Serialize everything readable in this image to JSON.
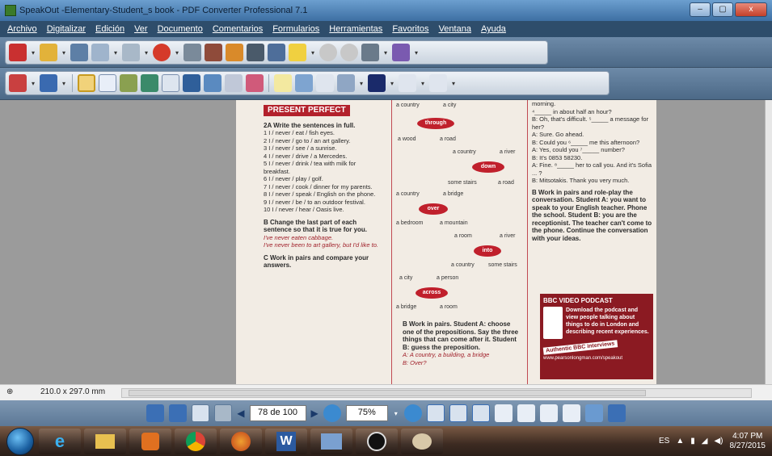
{
  "window": {
    "title": "SpeakOut -Elementary-Student_s book - PDF Converter Professional 7.1",
    "buttons": [
      "–",
      "▢",
      "x"
    ]
  },
  "menu": [
    "Archivo",
    "Digitalizar",
    "Edición",
    "Ver",
    "Documento",
    "Comentarios",
    "Formularios",
    "Herramientas",
    "Favoritos",
    "Ventana",
    "Ayuda"
  ],
  "page": {
    "heading": "PRESENT PERFECT",
    "exercise_a": "2A  Write the sentences in full.",
    "items": [
      "1  I / never / eat / fish eyes.",
      "2  I / never / go to / an art gallery.",
      "3  I / never / see / a sunrise.",
      "4  I / never / drive / a Mercedes.",
      "5  I / never / drink / tea with milk for breakfast.",
      "6  I / never / play / golf.",
      "7  I / never / cook / dinner for my parents.",
      "8  I / never / speak / English on the phone.",
      "9  I / never / be / to an outdoor festival.",
      "10  I / never / hear / Oasis live."
    ],
    "exercise_b": "B  Change the last part of each sentence so that it is true for you.",
    "example1": "I've never eaten cabbage.",
    "example2": "I've never been to art gallery, but I'd like to.",
    "exercise_c": "C  Work in pairs and compare your answers.",
    "prepositions": [
      "through",
      "down",
      "over",
      "into",
      "across"
    ],
    "middle_labels": [
      "a country",
      "a city",
      "a wood",
      "a road",
      "a country",
      "a river",
      "some stairs",
      "a road",
      "a country",
      "a bridge",
      "a bedroom",
      "a mountain",
      "a room",
      "a river",
      "a country",
      "some stairs",
      "a city",
      "a person",
      "a bridge",
      "a room"
    ],
    "middle_b": "B  Work in pairs. Student A: choose one of the prepositions. Say the three things that can come after it. Student B: guess the preposition.",
    "middle_eg": "A: A country, a building, a bridge",
    "middle_eg2": "B: Over?",
    "right_lines": [
      "morning.",
      "⁴_____ in about half an hour?",
      "B: Oh, that's difficult. ⁵_____ a message for her?",
      "A: Sure. Go ahead.",
      "B: Could you ⁶_____ me this afternoon?",
      "A: Yes, could you ⁷_____ number?",
      "B: It's 0853 58230.",
      "A: Fine. ⁸_____ her to call you. And it's Sofia ... ?",
      "B: Mitsotakis. Thank you very much."
    ],
    "right_b": "B  Work in pairs and role-play the conversation. Student A: you want to speak to your English teacher. Phone the school. Student B: you are the receptionist. The teacher can't come to the phone. Continue the conversation with your ideas.",
    "bbc_title": "BBC VIDEO PODCAST",
    "bbc_text": "Download the podcast and view people talking about things to do in London and describing recent experiences.",
    "bbc_tag": "Authentic BBC interviews",
    "bbc_url": "www.pearsonlongman.com/speakout"
  },
  "status": {
    "size": "210.0 x 297.0 mm"
  },
  "nav": {
    "page": "78 de 100",
    "zoom": "75%"
  },
  "taskbar": {
    "lang": "ES",
    "time": "4:07 PM",
    "date": "8/27/2015"
  }
}
